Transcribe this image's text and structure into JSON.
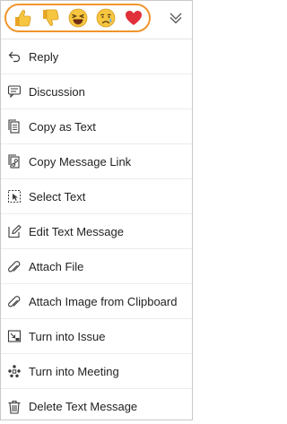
{
  "reactions": [
    {
      "name": "thumbs-up",
      "emoji": "👍"
    },
    {
      "name": "thumbs-down",
      "emoji": "👎"
    },
    {
      "name": "laughing",
      "emoji": "😆"
    },
    {
      "name": "crying",
      "emoji": "😢"
    },
    {
      "name": "heart",
      "emoji": "❤️"
    }
  ],
  "colors": {
    "highlight": "#f0952c",
    "emoji_yellow": "#f6c640",
    "heart_red": "#e0303a",
    "icon": "#3a3a3a"
  },
  "expand_icon": "chevrons-down-icon",
  "menu": {
    "items": [
      {
        "label": "Reply",
        "icon": "reply-icon"
      },
      {
        "label": "Discussion",
        "icon": "discussion-icon"
      },
      {
        "label": "Copy as Text",
        "icon": "copy-icon"
      },
      {
        "label": "Copy Message Link",
        "icon": "link-icon"
      },
      {
        "label": "Select Text",
        "icon": "select-text-icon"
      },
      {
        "label": "Edit Text Message",
        "icon": "edit-icon"
      },
      {
        "label": "Attach File",
        "icon": "paperclip-icon"
      },
      {
        "label": "Attach Image from Clipboard",
        "icon": "paperclip-icon"
      },
      {
        "label": "Turn into Issue",
        "icon": "issue-icon"
      },
      {
        "label": "Turn into Meeting",
        "icon": "meeting-icon"
      },
      {
        "label": "Delete Text Message",
        "icon": "trash-icon"
      }
    ]
  }
}
